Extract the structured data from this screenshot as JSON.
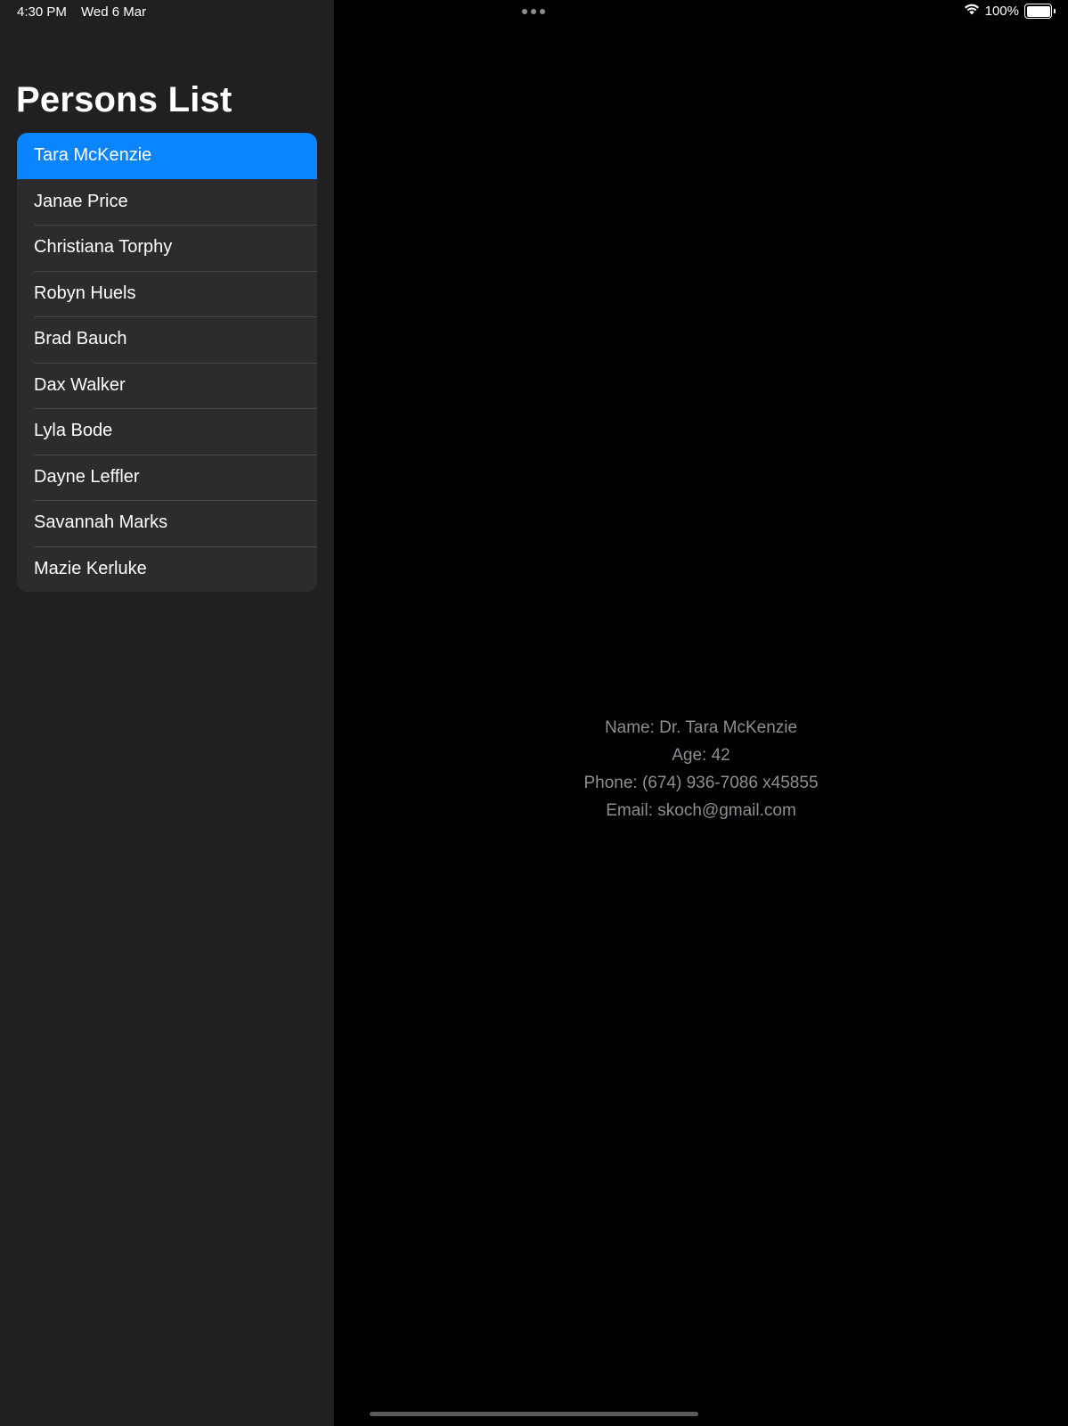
{
  "status_bar": {
    "time": "4:30 PM",
    "date": "Wed 6 Mar",
    "battery_percent": "100%",
    "battery_level": 1.0,
    "icons": [
      "wifi-icon",
      "battery-icon",
      "multitask-dots-icon"
    ]
  },
  "sidebar": {
    "title": "Persons List",
    "selected_index": 0,
    "persons": [
      {
        "name": "Tara McKenzie"
      },
      {
        "name": "Janae Price"
      },
      {
        "name": "Christiana Torphy"
      },
      {
        "name": "Robyn Huels"
      },
      {
        "name": "Brad Bauch"
      },
      {
        "name": "Dax Walker"
      },
      {
        "name": "Lyla Bode"
      },
      {
        "name": "Dayne Leffler"
      },
      {
        "name": "Savannah Marks"
      },
      {
        "name": "Mazie Kerluke"
      }
    ]
  },
  "detail": {
    "name_line": "Name: Dr. Tara McKenzie",
    "age_line": "Age: 42",
    "phone_line": "Phone: (674) 936-7086 x45855",
    "email_line": "Email: skoch@gmail.com"
  },
  "colors": {
    "accent": "#0a84ff",
    "sidebar_bg": "#202020",
    "list_bg": "#2c2c2e",
    "detail_bg": "#000000",
    "secondary_text": "#8e8e93"
  }
}
